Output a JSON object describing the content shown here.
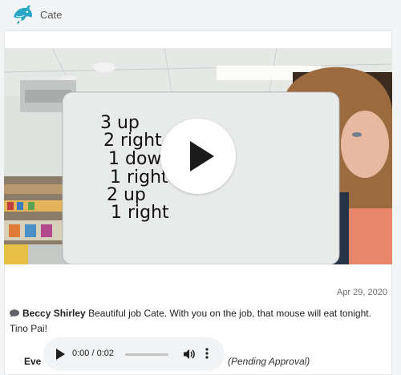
{
  "header": {
    "username": "Cate",
    "avatar_icon": "dolphin-icon"
  },
  "post": {
    "date": "Apr 29, 2020",
    "whiteboard_text": [
      "3 up",
      "2 right",
      "1 down",
      "1 right",
      "2 up",
      "1 right"
    ]
  },
  "comment": {
    "author": "Beccy Shirley",
    "text": "Beautiful job Cate. With you on the job, that mouse will eat tonight. Tino Pai!"
  },
  "audio": {
    "author_label": "Eve",
    "time": "0:00 / 0:02",
    "status": "(Pending Approval)"
  },
  "colors": {
    "accent": "#2ba7c6",
    "background": "#f3f4f5"
  }
}
